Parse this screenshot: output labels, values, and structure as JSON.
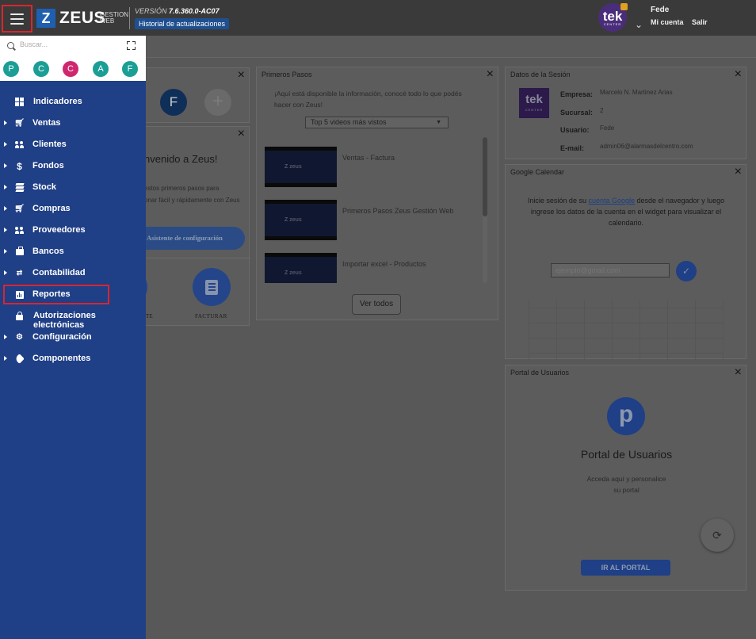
{
  "topbar": {
    "logo_letter": "Z",
    "logo_word": "ZEUS",
    "logo_sub_1": "GESTION",
    "logo_sub_2": "WEB",
    "version_label": "VERSIÓN",
    "version_number": "7.6.360.0-AC07",
    "history_button": "Historial de actualizaciones",
    "avatar_text": "tek",
    "avatar_sub": "CENTER",
    "user_name": "Fede",
    "my_account": "Mi cuenta",
    "logout": "Salir"
  },
  "sidebar": {
    "search_placeholder": "Buscar...",
    "quick_access": [
      {
        "letter": "P",
        "color": "#1a9e96"
      },
      {
        "letter": "C",
        "color": "#1a9e96"
      },
      {
        "letter": "C",
        "color": "#d0266e"
      },
      {
        "letter": "A",
        "color": "#1a9e96"
      },
      {
        "letter": "F",
        "color": "#1a9e96"
      }
    ],
    "items": [
      {
        "label": "Indicadores",
        "icon": "dashboard-icon"
      },
      {
        "label": "Ventas",
        "icon": "cart-icon"
      },
      {
        "label": "Clientes",
        "icon": "users-icon"
      },
      {
        "label": "Fondos",
        "icon": "dollar-icon"
      },
      {
        "label": "Stock",
        "icon": "layers-icon"
      },
      {
        "label": "Compras",
        "icon": "cart-plus-icon"
      },
      {
        "label": "Proveedores",
        "icon": "users-icon"
      },
      {
        "label": "Bancos",
        "icon": "briefcase-icon"
      },
      {
        "label": "Contabilidad",
        "icon": "ledger-icon"
      },
      {
        "label": "Reportes",
        "icon": "bar-chart-icon"
      },
      {
        "label": "Autorizaciones electrónicas",
        "icon": "lock-icon"
      },
      {
        "label": "Configuración",
        "icon": "gears-icon"
      },
      {
        "label": "Componentes",
        "icon": "tags-icon"
      }
    ]
  },
  "widgets": {
    "quick": {
      "avatar_letter": "F"
    },
    "welcome": {
      "title": "nvenido a Zeus!",
      "text": "estos primeros pasos para\nonar fácil y rápidamente con Zeus",
      "button": "Asistente de configuración",
      "action_left": "NTE",
      "action_right": "FACTURAR"
    },
    "primeros_pasos": {
      "title": "Primeros Pasos",
      "intro": "¡Aquí está disponible la información, conocé todo lo que podés hacer con Zeus!",
      "select": "Top 5 videos más vistos",
      "videos": [
        "Ventas - Factura",
        "Primeros Pasos Zeus Gestión Web",
        "Importar excel - Productos"
      ],
      "button": "Ver todos"
    },
    "sesion": {
      "title": "Datos de la Sesión",
      "logo": "tek",
      "logo_sub": "CENTER",
      "rows": [
        {
          "label": "Empresa:",
          "value": "Marcelo N. Martinez Arias"
        },
        {
          "label": "Sucursal:",
          "value": "2"
        },
        {
          "label": "Usuario:",
          "value": "Fede"
        },
        {
          "label": "E-mail:",
          "value": "admin06@alarmasdelcentro.com"
        }
      ]
    },
    "calendar": {
      "title": "Google Calendar",
      "text_before": "Inicie sesión de su ",
      "link": "cuenta Google",
      "text_after": " desde el navegador y luego ingrese los datos de la cuenta en el widget para visualizar el calendario.",
      "placeholder": "ejemplo@gmail.com"
    },
    "portal": {
      "title": "Portal de Usuarios",
      "logo_letter": "p",
      "heading": "Portal de Usuarios",
      "sub_1": "Acceda aquí y personalice",
      "sub_2": "su portal",
      "button": "IR AL PORTAL"
    }
  }
}
